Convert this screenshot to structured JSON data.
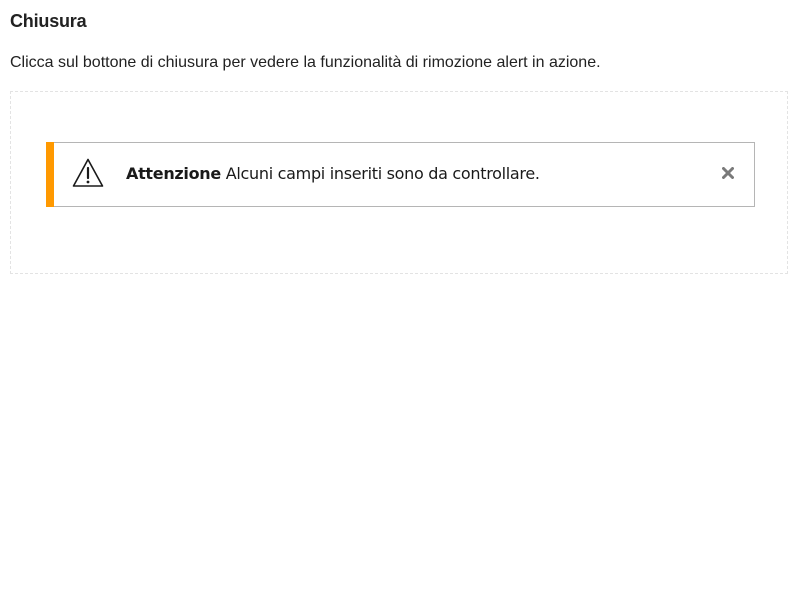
{
  "section": {
    "title": "Chiusura",
    "description": "Clicca sul bottone di chiusura per vedere la funzionalità di rimozione alert in azione."
  },
  "alert": {
    "type": "warning",
    "accent_color": "#ff9900",
    "icon": "warning-triangle-icon",
    "strong_label": "Attenzione",
    "message": " Alcuni campi inseriti sono da controllare.",
    "close_icon": "close-icon",
    "close_color": "#7a7a7a"
  }
}
